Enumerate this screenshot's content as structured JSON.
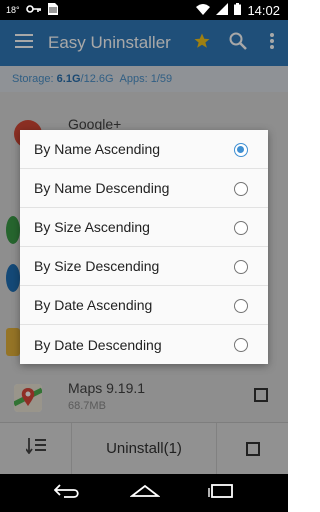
{
  "status_bar": {
    "temperature": "18°",
    "time": "14:02"
  },
  "app_bar": {
    "title": "Easy Uninstaller"
  },
  "storage": {
    "label": "Storage:",
    "used": "6.1G",
    "total": "/12.6G",
    "apps_label": "Apps:",
    "apps_value": "1/59"
  },
  "list": [
    {
      "name": "Google+",
      "size": "",
      "icon_color": "#d34836"
    },
    {
      "name": "Maps 9.19.1",
      "size": "68.7MB",
      "icon_color": "#4caf50"
    }
  ],
  "dialog": {
    "options": [
      {
        "label": "By Name Ascending",
        "selected": true
      },
      {
        "label": "By Name Descending",
        "selected": false
      },
      {
        "label": "By Size Ascending",
        "selected": false
      },
      {
        "label": "By Size Descending",
        "selected": false
      },
      {
        "label": "By Date Ascending",
        "selected": false
      },
      {
        "label": "By Date Descending",
        "selected": false
      }
    ]
  },
  "bottom_bar": {
    "uninstall_label": "Uninstall(1)"
  },
  "colors": {
    "accent": "#2f79b8",
    "radio_selected": "#3f8fd2",
    "star": "#f2c21b"
  },
  "icons": [
    "menu-icon",
    "star-icon",
    "search-icon",
    "more-vert-icon",
    "sort-icon",
    "back-icon",
    "home-icon",
    "recents-icon",
    "key-icon",
    "sim-icon",
    "wifi-icon",
    "signal-icon",
    "battery-icon"
  ]
}
